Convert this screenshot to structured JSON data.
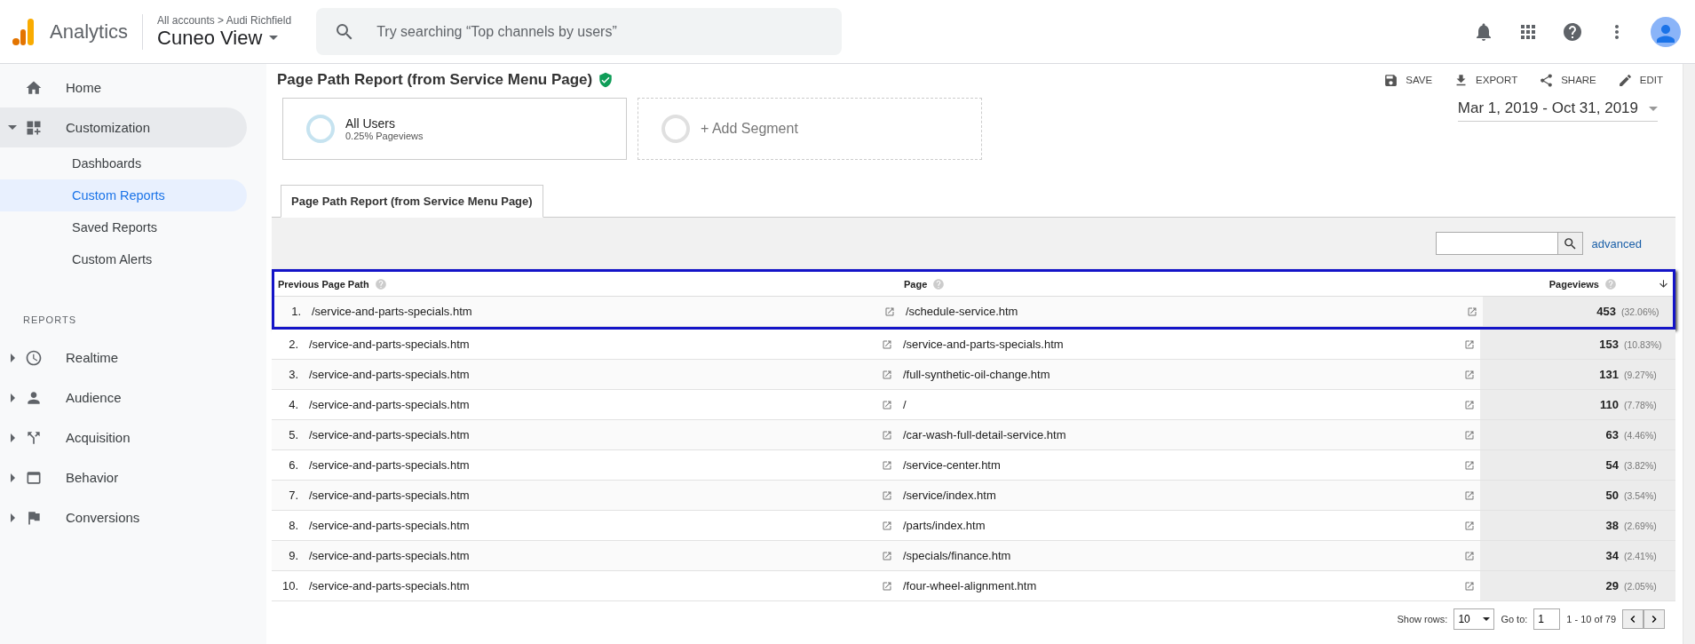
{
  "header": {
    "product": "Analytics",
    "breadcrumb": "All accounts > Audi Richfield",
    "view": "Cuneo View",
    "search": {
      "placeholder": "Try searching “Top channels by users”"
    }
  },
  "sidebar": {
    "items": [
      {
        "label": "Home",
        "selected": false
      },
      {
        "label": "Customization",
        "selected": false,
        "expanded": true,
        "children": [
          {
            "label": "Dashboards",
            "selected": false
          },
          {
            "label": "Custom Reports",
            "selected": true
          },
          {
            "label": "Saved Reports",
            "selected": false
          },
          {
            "label": "Custom Alerts",
            "selected": false
          }
        ]
      }
    ],
    "section": "REPORTS",
    "reports": [
      {
        "label": "Realtime",
        "expanded": false
      },
      {
        "label": "Audience",
        "expanded": false
      },
      {
        "label": "Acquisition",
        "expanded": false
      },
      {
        "label": "Behavior",
        "expanded": false
      },
      {
        "label": "Conversions",
        "expanded": false
      }
    ]
  },
  "report": {
    "title": "Page Path Report (from Service Menu Page)",
    "actions": [
      "SAVE",
      "EXPORT",
      "SHARE",
      "EDIT"
    ],
    "segments": [
      {
        "kind": "active",
        "name": "All Users",
        "detail": "0.25% Pageviews"
      },
      {
        "kind": "add",
        "name": "+ Add Segment"
      }
    ],
    "date_range": "Mar 1, 2019 - Oct 31, 2019",
    "tabs": [
      {
        "label": "Page Path Report (from Service Menu Page)",
        "selected": true
      }
    ],
    "advanced": "advanced"
  },
  "table": {
    "columns": [
      "Previous Page Path",
      "Page",
      "Pageviews"
    ],
    "header_outlined": true,
    "rows": [
      {
        "index": "1.",
        "previous": "/service-and-parts-specials.htm",
        "page": "/schedule-service.htm",
        "pageviews": "453",
        "share": "(32.06%)",
        "outlined": true
      },
      {
        "index": "2.",
        "previous": "/service-and-parts-specials.htm",
        "page": "/service-and-parts-specials.htm",
        "pageviews": "153",
        "share": "(10.83%)",
        "outlined": false
      },
      {
        "index": "3.",
        "previous": "/service-and-parts-specials.htm",
        "page": "/full-synthetic-oil-change.htm",
        "pageviews": "131",
        "share": "(9.27%)",
        "outlined": false
      },
      {
        "index": "4.",
        "previous": "/service-and-parts-specials.htm",
        "page": "/",
        "pageviews": "110",
        "share": "(7.78%)",
        "outlined": false
      },
      {
        "index": "5.",
        "previous": "/service-and-parts-specials.htm",
        "page": "/car-wash-full-detail-service.htm",
        "pageviews": "63",
        "share": "(4.46%)",
        "outlined": false
      },
      {
        "index": "6.",
        "previous": "/service-and-parts-specials.htm",
        "page": "/service-center.htm",
        "pageviews": "54",
        "share": "(3.82%)",
        "outlined": false
      },
      {
        "index": "7.",
        "previous": "/service-and-parts-specials.htm",
        "page": "/service/index.htm",
        "pageviews": "50",
        "share": "(3.54%)",
        "outlined": false
      },
      {
        "index": "8.",
        "previous": "/service-and-parts-specials.htm",
        "page": "/parts/index.htm",
        "pageviews": "38",
        "share": "(2.69%)",
        "outlined": false
      },
      {
        "index": "9.",
        "previous": "/service-and-parts-specials.htm",
        "page": "/specials/finance.htm",
        "pageviews": "34",
        "share": "(2.41%)",
        "outlined": false
      },
      {
        "index": "10.",
        "previous": "/service-and-parts-specials.htm",
        "page": "/four-wheel-alignment.htm",
        "pageviews": "29",
        "share": "(2.05%)",
        "outlined": false
      }
    ]
  },
  "pagination": {
    "show_rows_label": "Show rows:",
    "rows_value": "10",
    "goto_label": "Go to:",
    "goto_value": "1",
    "range": "1 - 10 of 79"
  }
}
